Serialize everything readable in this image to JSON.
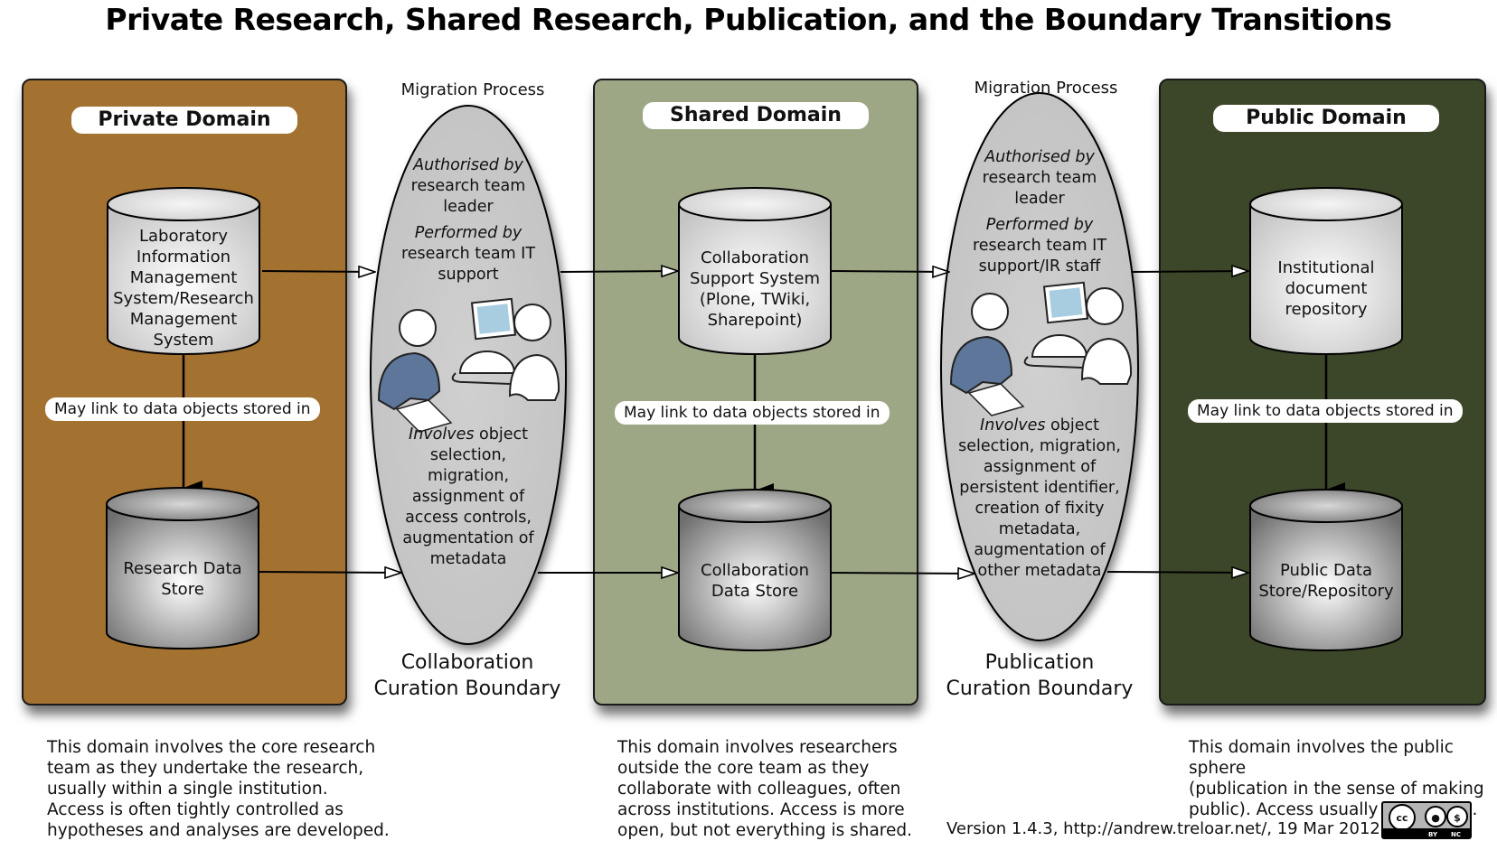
{
  "title": "Private Research, Shared Research, Publication, and the Boundary Transitions",
  "domains": [
    {
      "name": "Private Domain",
      "color": "#a37130",
      "top_system": [
        "Laboratory",
        "Information",
        "Management",
        "System/Research",
        "Management",
        "System"
      ],
      "link_label": "May link to data objects stored in",
      "data_store": [
        "Research Data",
        "Store"
      ],
      "description": "This domain involves the core research\nteam as they undertake the research,\nusually within a single institution.\nAccess is often tightly controlled as\nhypotheses and analyses are developed."
    },
    {
      "name": "Shared Domain",
      "color": "#9da785",
      "top_system": [
        "Collaboration",
        "Support System",
        "(Plone, TWiki,",
        "Sharepoint)"
      ],
      "link_label": "May link to data objects stored in",
      "data_store": [
        "Collaboration",
        "Data Store"
      ],
      "description": "This domain involves researchers\noutside the core team as they\ncollaborate with colleagues, often\nacross institutions.  Access is more\nopen, but not everything is shared."
    },
    {
      "name": "Public Domain",
      "color": "#3c4629",
      "top_system": [
        "Institutional",
        "document",
        "repository"
      ],
      "link_label": "May link to data objects stored in",
      "data_store": [
        "Public Data",
        "Store/Repository"
      ],
      "description": "This domain involves the public sphere\n(publication in the sense of making\npublic).  Access usually open to all."
    }
  ],
  "boundaries": [
    {
      "header": "Migration Process",
      "authorised_prefix": "Authorised by",
      "authorised_by": [
        "research team",
        "leader"
      ],
      "performed_prefix": "Performed by",
      "performed_by": [
        "research team IT",
        "support"
      ],
      "involves_prefix": "Involves",
      "involves": [
        " object",
        "selection,",
        "migration,",
        "assignment of",
        "access controls,",
        "augmentation of",
        "metadata"
      ],
      "label": [
        "Collaboration",
        "Curation Boundary"
      ]
    },
    {
      "header": "Migration Process",
      "authorised_prefix": "Authorised by",
      "authorised_by": [
        "research team",
        "leader"
      ],
      "performed_prefix": "Performed by",
      "performed_by": [
        "research team IT",
        "support/IR staff"
      ],
      "involves_prefix": "Involves",
      "involves": [
        " object",
        "selection, migration,",
        "assignment of",
        "persistent identifier,",
        "creation of fixity",
        "metadata,",
        "augmentation of",
        "other metadata"
      ],
      "label": [
        "Publication",
        "Curation Boundary"
      ]
    }
  ],
  "footer": {
    "version": "Version 1.4.3,  http://andrew.treloar.net/, 19 Mar 2012",
    "license_badge": {
      "main": "cc",
      "tags": [
        "BY",
        "NC"
      ],
      "icons": [
        "cc-icon",
        "attribution-icon",
        "non-commercial-icon"
      ]
    }
  },
  "colors": {
    "ellipse_fill": "#c9c9c9",
    "person_blue": "#5d7699",
    "screen_blue": "#a8cde0"
  }
}
